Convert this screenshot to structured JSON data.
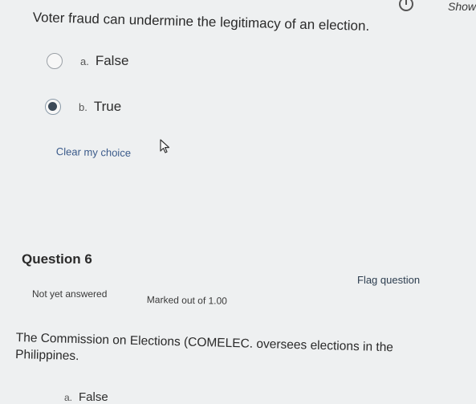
{
  "header": {
    "show_label": "Show",
    "timer_icon": "power-icon"
  },
  "question5": {
    "text": "Voter fraud can undermine the legitimacy of an election.",
    "options": [
      {
        "letter": "a.",
        "label": "False",
        "checked": false
      },
      {
        "letter": "b.",
        "label": "True",
        "checked": true
      }
    ],
    "clear_choice": "Clear my choice"
  },
  "question6": {
    "title": "Question 6",
    "flag": "Flag question",
    "status": "Not yet answered",
    "marked": "Marked out of 1.00",
    "text": "The Commission on Elections (COMELEC. oversees elections in the Philippines.",
    "options": [
      {
        "letter": "a.",
        "label": "False",
        "checked": false
      }
    ]
  }
}
